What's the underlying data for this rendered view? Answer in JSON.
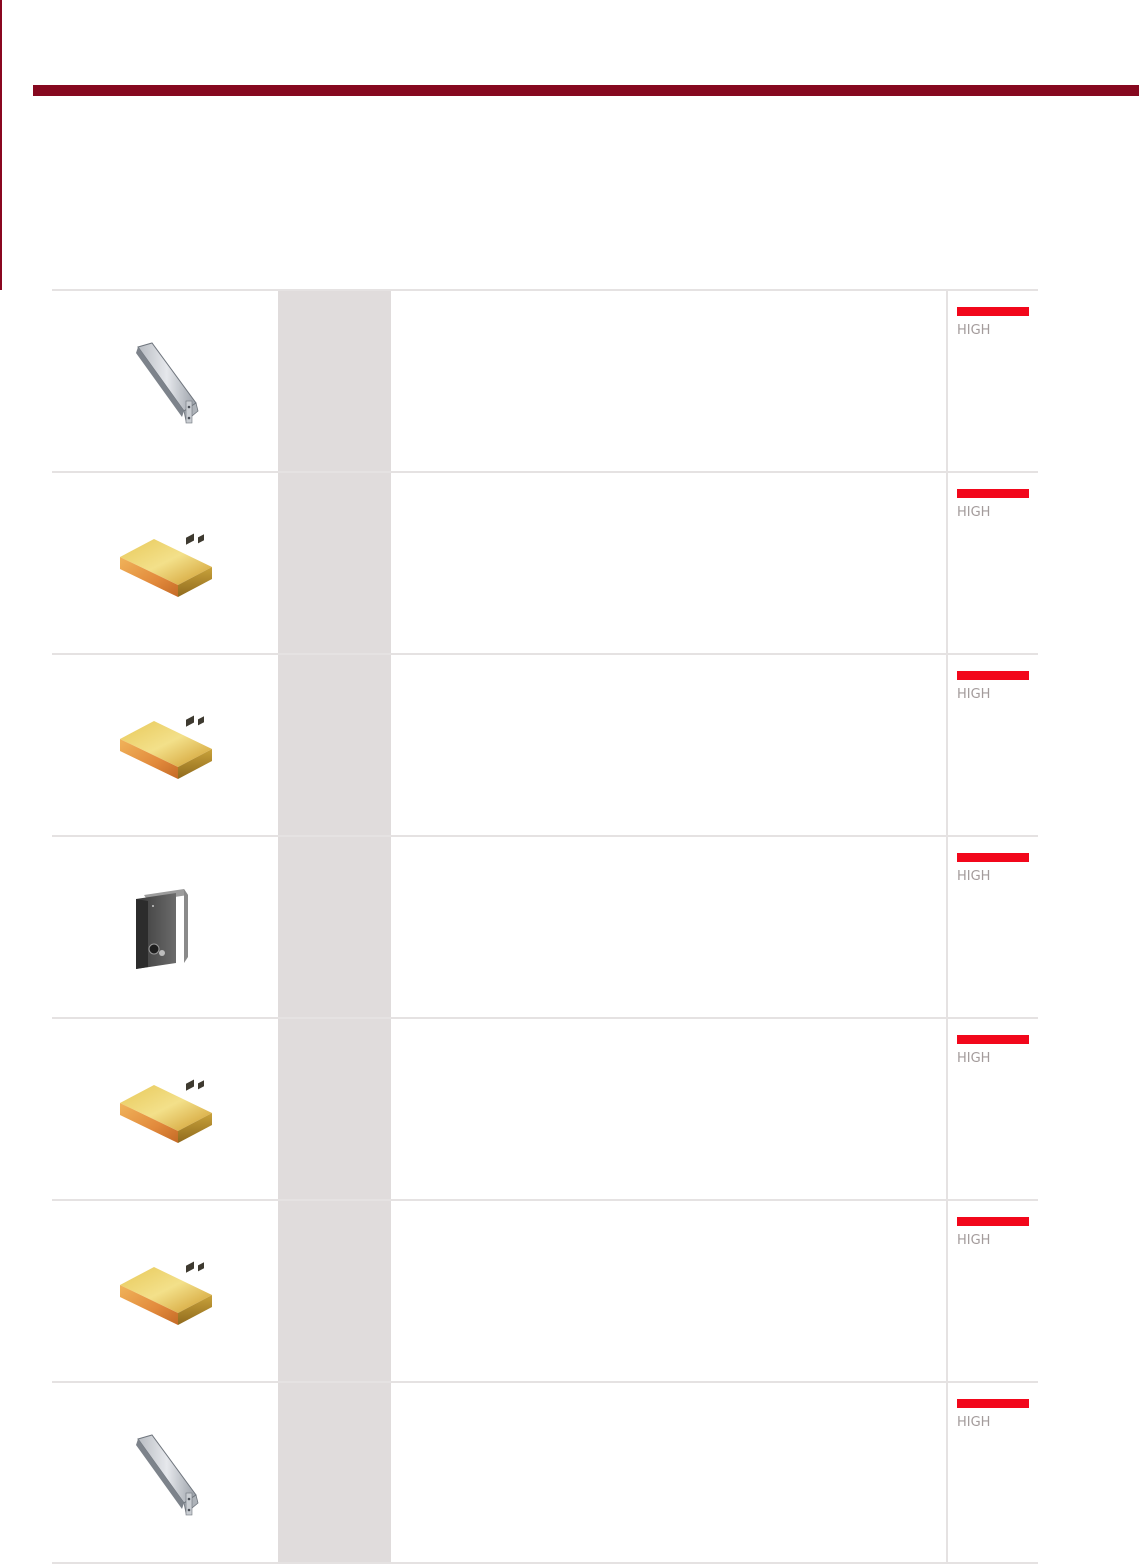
{
  "colors": {
    "header_bar": "#86081f",
    "code_column": "#e0dcdc",
    "level_bar": "#f2071b",
    "level_text": "#a39b9b"
  },
  "products": [
    {
      "image_icon": "rack-module-icon",
      "level": "HIGH"
    },
    {
      "image_icon": "gold-power-supply-icon",
      "level": "HIGH"
    },
    {
      "image_icon": "gold-power-supply-icon",
      "level": "HIGH"
    },
    {
      "image_icon": "grey-enclosure-icon",
      "level": "HIGH"
    },
    {
      "image_icon": "gold-power-supply-icon",
      "level": "HIGH"
    },
    {
      "image_icon": "gold-power-supply-icon",
      "level": "HIGH"
    },
    {
      "image_icon": "rack-module-icon",
      "level": "HIGH"
    }
  ]
}
